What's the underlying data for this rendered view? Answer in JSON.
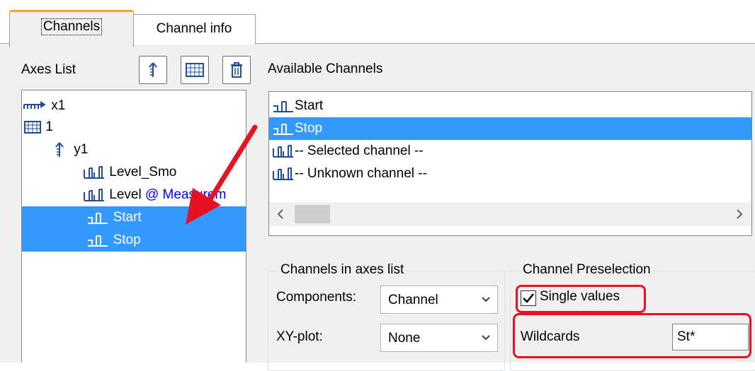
{
  "tabs": [
    {
      "label": "Channels",
      "active": true
    },
    {
      "label": "Channel info",
      "active": false
    }
  ],
  "axes_list": {
    "label": "Axes List",
    "items": [
      {
        "icon": "x-axis-icon",
        "label": "x1",
        "indent": 0
      },
      {
        "icon": "grid-icon",
        "label": "1",
        "indent": 0
      },
      {
        "icon": "y-axis-icon",
        "label": "y1",
        "indent": 1
      },
      {
        "icon": "channel-icon",
        "label": "Level_Smo",
        "indent": 2
      },
      {
        "icon": "channel-icon",
        "label": "Level",
        "suffix": "@ Measurem",
        "indent": 2
      },
      {
        "icon": "channel-icon",
        "label": "Start",
        "indent": 2,
        "selected": true
      },
      {
        "icon": "channel-icon",
        "label": "Stop",
        "indent": 2,
        "selected": true
      }
    ]
  },
  "toolbar": [
    {
      "icon": "add-y-axis-icon"
    },
    {
      "icon": "add-grid-icon"
    },
    {
      "icon": "delete-icon"
    }
  ],
  "available_channels": {
    "label": "Available Channels",
    "items": [
      {
        "label": "Start",
        "selected": false
      },
      {
        "label": "Stop",
        "selected": true
      },
      {
        "label": "-- Selected channel --",
        "selected": false
      },
      {
        "label": "-- Unknown channel --",
        "selected": false
      }
    ]
  },
  "channels_in_axes_list": {
    "title": "Channels in axes list",
    "components_label": "Components:",
    "components_value": "Channel",
    "xyplot_label": "XY-plot:",
    "xyplot_value": "None"
  },
  "channel_preselection": {
    "title": "Channel Preselection",
    "single_values_label": "Single values",
    "single_values_checked": true,
    "wildcards_label": "Wildcards",
    "wildcards_value": "St*"
  },
  "colors": {
    "selection": "#3399ff",
    "highlight": "#e81123",
    "link": "#0000ff",
    "tab_accent": "#f4a626"
  }
}
